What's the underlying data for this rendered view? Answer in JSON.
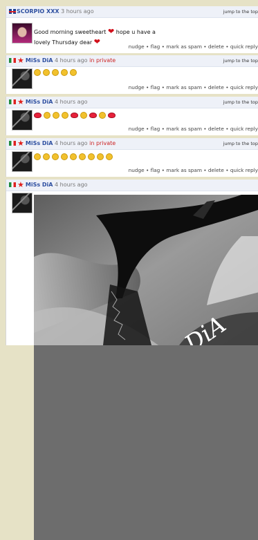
{
  "posts": [
    {
      "flag": "uk-flag-icon",
      "author": "SCORPIO XXX",
      "time": "3 hours ago",
      "private": "",
      "jump": "jump to the top",
      "message_before": "Good morning sweetheart",
      "message_middle": "hope u have a",
      "message_after": "lovely Thursday dear",
      "emoji": [],
      "actions": "nudge • flag • mark as spam • delete • quick reply"
    },
    {
      "flag": "mexico-flag-icon",
      "author": "MiSs DiA",
      "time": "4 hours ago",
      "private": "in private",
      "jump": "jump to the top",
      "emoji": [
        "laugh",
        "laugh",
        "laugh",
        "laugh",
        "laugh"
      ],
      "actions": "nudge • flag • mark as spam • delete • quick reply"
    },
    {
      "flag": "mexico-flag-icon",
      "author": "MiSs DiA",
      "time": "4 hours ago",
      "private": "",
      "jump": "jump to the top",
      "emoji": [
        "kiss",
        "wink",
        "wink",
        "wink",
        "kiss",
        "wink",
        "kiss",
        "wink",
        "kiss"
      ],
      "actions": "nudge • flag • mark as spam • delete • quick reply"
    },
    {
      "flag": "mexico-flag-icon",
      "author": "MiSs DiA",
      "time": "4 hours ago",
      "private": "in private",
      "jump": "jump to the top",
      "emoji": [
        "laugh",
        "laugh",
        "laugh",
        "laugh",
        "laugh",
        "laugh",
        "wink",
        "wink",
        "wink"
      ],
      "actions": "nudge • flag • mark as spam • delete • quick reply"
    },
    {
      "flag": "mexico-flag-icon",
      "author": "MiSs DiA",
      "time": "4 hours ago",
      "private": "",
      "jump": "jump to the top",
      "image_signature": "DiA"
    }
  ],
  "colors": {
    "author": "#2d4fa0",
    "private": "#cc2222",
    "heart": "#d10f1a",
    "page_bg": "#e6e2c6"
  }
}
